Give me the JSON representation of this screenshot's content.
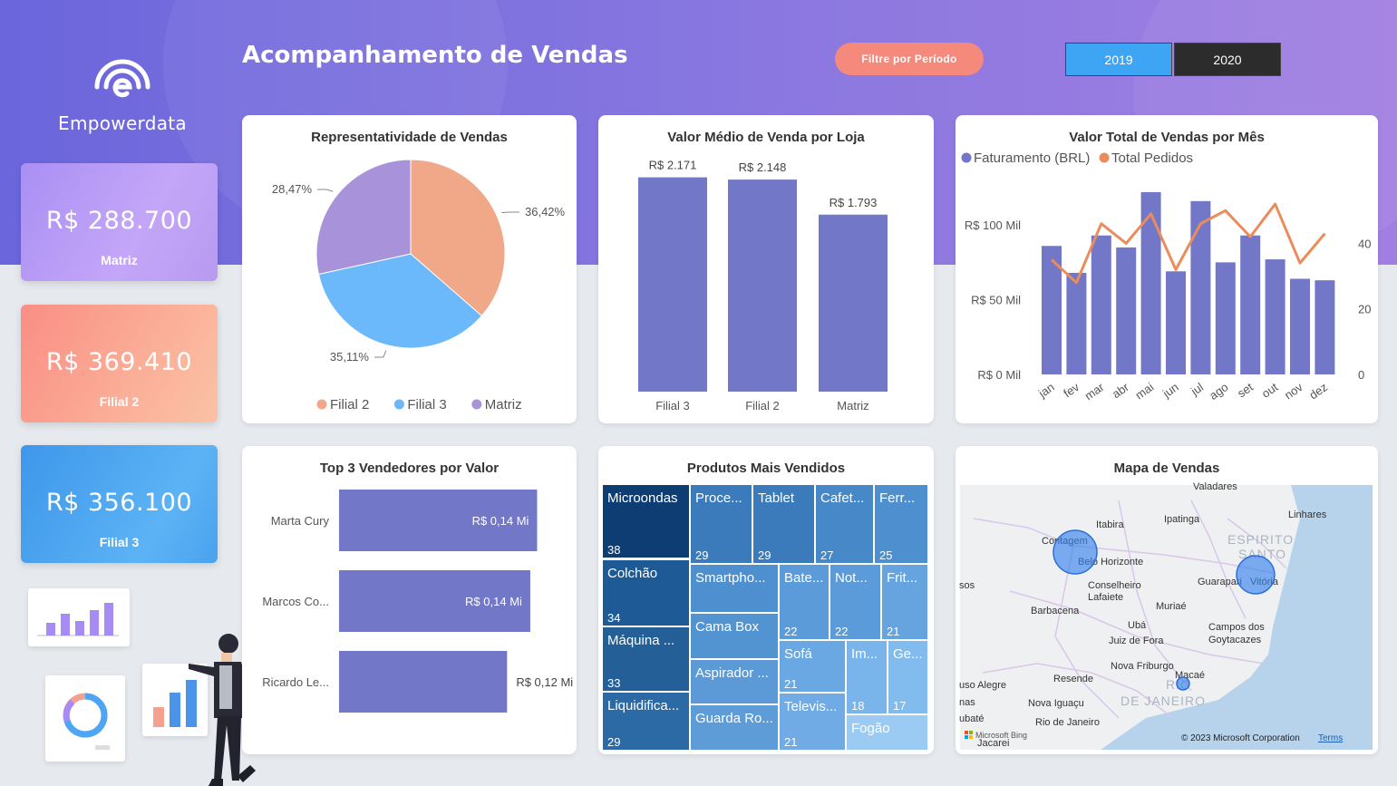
{
  "header": {
    "brand": "Empowerdata",
    "title": "Acompanhamento de Vendas",
    "filter_label": "Filtre por Período",
    "years": [
      "2019",
      "2020"
    ]
  },
  "kpis": [
    {
      "value": "R$ 288.700",
      "label": "Matriz"
    },
    {
      "value": "R$ 369.410",
      "label": "Filial 2"
    },
    {
      "value": "R$ 356.100",
      "label": "Filial 3"
    }
  ],
  "colors": {
    "filial2": "#f0a888",
    "filial3": "#6bb8fb",
    "matriz": "#a892da",
    "bar": "#7277c7",
    "line": "#ea8c5c"
  },
  "pie": {
    "title": "Representatividade de Vendas"
  },
  "avg": {
    "title": "Valor Médio de Venda por Loja"
  },
  "monthly": {
    "title": "Valor Total de Vendas por Mês"
  },
  "sellers": {
    "title": "Top 3 Vendedores por Valor"
  },
  "products": {
    "title": "Produtos Mais Vendidos"
  },
  "map": {
    "title": "Mapa de Vendas",
    "copyright": "© 2023 Microsoft Corporation",
    "terms": "Terms",
    "bing": "Microsoft Bing",
    "places": [
      "Valadares",
      "Itabira",
      "Ipatinga",
      "Linhares",
      "Contagem",
      "Belo Horizonte",
      "ESPIRITO",
      "SANTO",
      "Conselheiro",
      "Lafaiete",
      "Guarapari",
      "Vitória",
      "Barbacena",
      "Muriaé",
      "Ubá",
      "Campos dos",
      "Goytacazes",
      "Juiz de Fora",
      "Nova Friburgo",
      "Resende",
      "Macaé",
      "RIO",
      "DE JANEIRO",
      "Nova Iguaçu",
      "Rio de Janeiro",
      "Jacarei",
      "sos",
      "uso Alegre",
      "ubaté",
      "nas"
    ]
  },
  "chart_data": [
    {
      "type": "pie",
      "title": "Representatividade de Vendas",
      "categories": [
        "Filial 2",
        "Filial 3",
        "Matriz"
      ],
      "values": [
        36.42,
        35.11,
        28.47
      ],
      "labels": [
        "36,42%",
        "35,11%",
        "28,47%"
      ],
      "legend": "bottom"
    },
    {
      "type": "bar",
      "title": "Valor Médio de Venda por Loja",
      "categories": [
        "Filial 3",
        "Filial 2",
        "Matriz"
      ],
      "values": [
        2171,
        2148,
        1793
      ],
      "labels": [
        "R$ 2.171",
        "R$ 2.148",
        "R$ 1.793"
      ]
    },
    {
      "type": "bar",
      "title": "Valor Total de Vendas por Mês",
      "categories": [
        "jan",
        "fev",
        "mar",
        "abr",
        "mai",
        "jun",
        "jul",
        "ago",
        "set",
        "out",
        "nov",
        "dez"
      ],
      "series": [
        {
          "name": "Faturamento (BRL)",
          "type": "bar",
          "axis": "left",
          "values": [
            86000,
            68000,
            93000,
            85000,
            122000,
            69000,
            116000,
            75000,
            93000,
            77000,
            64000,
            63000
          ]
        },
        {
          "name": "Total Pedidos",
          "type": "line",
          "axis": "right",
          "values": [
            35,
            28,
            46,
            40,
            49,
            32,
            46,
            50,
            42,
            52,
            34,
            43
          ]
        }
      ],
      "ylim": [
        0,
        125000
      ],
      "y_ticks": [
        "R$ 0 Mil",
        "R$ 50 Mil",
        "R$ 100 Mil"
      ],
      "y2lim": [
        0,
        57
      ],
      "y2_ticks": [
        "0",
        "20",
        "40"
      ],
      "legend": "top-left"
    },
    {
      "type": "bar",
      "orientation": "horizontal",
      "title": "Top 3 Vendedores por Valor",
      "categories": [
        "Marta Cury",
        "Marcos Co...",
        "Ricardo Le..."
      ],
      "values": [
        0.145,
        0.14,
        0.123
      ],
      "labels": [
        "R$ 0,14 Mi",
        "R$ 0,14 Mi",
        "R$ 0,12 Mi"
      ]
    },
    {
      "type": "treemap",
      "title": "Produtos Mais Vendidos",
      "categories": [
        "Microondas",
        "Colchão",
        "Máquina ...",
        "Liquidifica...",
        "Proce...",
        "Tablet",
        "Cafet...",
        "Ferr...",
        "Smartpho...",
        "Bate...",
        "Not...",
        "Frit...",
        "Cama Box",
        "Sofá",
        "Im...",
        "Ge...",
        "Aspirador ...",
        "Televis...",
        "Guarda Ro...",
        "Fogão"
      ],
      "values": [
        38,
        34,
        33,
        29,
        29,
        29,
        27,
        25,
        null,
        22,
        22,
        21,
        null,
        21,
        18,
        17,
        null,
        21,
        null,
        null
      ]
    }
  ]
}
